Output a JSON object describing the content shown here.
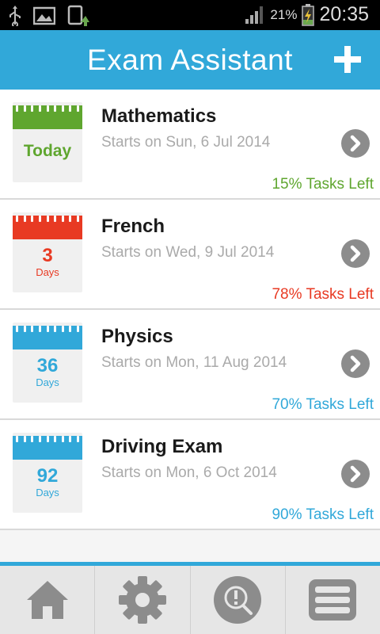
{
  "status_bar": {
    "battery_percent": "21%",
    "time": "20:35",
    "icons": [
      "usb-icon",
      "gallery-icon",
      "screen-rotate-icon",
      "signal-icon",
      "battery-charging-icon"
    ]
  },
  "header": {
    "title": "Exam Assistant",
    "add_icon": "plus-icon"
  },
  "colors": {
    "accent": "#31a8d9",
    "green": "#5fa62f",
    "red": "#e83a23",
    "blue": "#31a8d9"
  },
  "exams": [
    {
      "name": "Mathematics",
      "date": "Starts on Sun, 6 Jul 2014",
      "countdown": "Today",
      "unit": "",
      "tasks": "15% Tasks Left",
      "color": "#5fa62f"
    },
    {
      "name": "French",
      "date": "Starts on Wed, 9 Jul 2014",
      "countdown": "3",
      "unit": "Days",
      "tasks": "78% Tasks Left",
      "color": "#e83a23"
    },
    {
      "name": "Physics",
      "date": "Starts on Mon, 11 Aug 2014",
      "countdown": "36",
      "unit": "Days",
      "tasks": "70% Tasks Left",
      "color": "#31a8d9"
    },
    {
      "name": "Driving Exam",
      "date": "Starts on Mon, 6 Oct 2014",
      "countdown": "92",
      "unit": "Days",
      "tasks": "90% Tasks Left",
      "color": "#31a8d9"
    }
  ],
  "bottom_nav": [
    {
      "icon": "home-icon"
    },
    {
      "icon": "settings-gear-icon"
    },
    {
      "icon": "search-tips-icon"
    },
    {
      "icon": "menu-list-icon"
    }
  ]
}
